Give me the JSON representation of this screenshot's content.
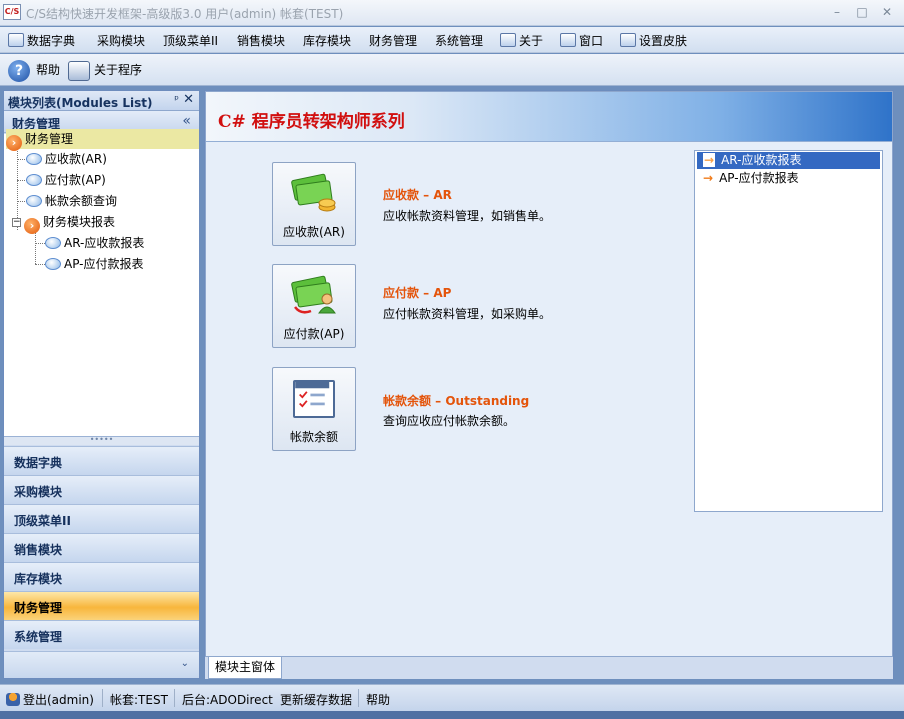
{
  "window": {
    "title": "C/S结构快速开发框架-高级版3.0 用户(admin) 帐套(TEST)",
    "app_icon_text": "C/S",
    "minimize": "–",
    "maximize": "□",
    "close": "✕"
  },
  "menu": {
    "items": [
      "数据字典",
      "采购模块",
      "顶级菜单II",
      "销售模块",
      "库存模块",
      "财务管理",
      "系统管理",
      "关于",
      "窗口",
      "设置皮肤"
    ]
  },
  "toolbar": {
    "help_label": "帮助",
    "help_glyph": "?",
    "about_label": "关于程序"
  },
  "left_panel": {
    "title": "模块列表(Modules List)",
    "pin": "ᵖ",
    "close": "✕",
    "group_title": "财务管理",
    "collapse": "«",
    "tree": [
      {
        "label": "财务管理"
      },
      {
        "label": "应收款(AR)"
      },
      {
        "label": "应付款(AP)"
      },
      {
        "label": "帐款余额查询"
      },
      {
        "label": "财务模块报表"
      },
      {
        "label": "AR-应收款报表"
      },
      {
        "label": "AP-应付款报表"
      }
    ],
    "splitter": "•••••",
    "nav": [
      "数据字典",
      "采购模块",
      "顶级菜单II",
      "销售模块",
      "库存模块",
      "财务管理",
      "系统管理"
    ],
    "nav_more": "⌄"
  },
  "main": {
    "banner_title": "C# 程序员转架构师系列",
    "modules": [
      {
        "button": "应收款(AR)",
        "title": "应收款 – AR",
        "desc": "应收帐款资料管理，如销售单。"
      },
      {
        "button": "应付款(AP)",
        "title": "应付款 – AP",
        "desc": "应付帐款资料管理，如采购单。"
      },
      {
        "button": "帐款余额",
        "title": "帐款余额 – Outstanding",
        "desc": "查询应收应付帐款余额。"
      }
    ],
    "reports": [
      {
        "label": "AR-应收款报表"
      },
      {
        "label": "AP-应付款报表"
      }
    ],
    "report_arrow": "→",
    "tab": "模块主窗体"
  },
  "statusbar": {
    "logout": "登出(admin)",
    "account": "帐套:TEST",
    "backend": "后台:ADODirect",
    "refresh": "更新缓存数据",
    "help": "帮助"
  },
  "colors": {
    "banner_title": "#d10f0f",
    "module_title": "#e4540b",
    "selected_nav": "#f8b63c",
    "selected_report": "#3469c2"
  }
}
